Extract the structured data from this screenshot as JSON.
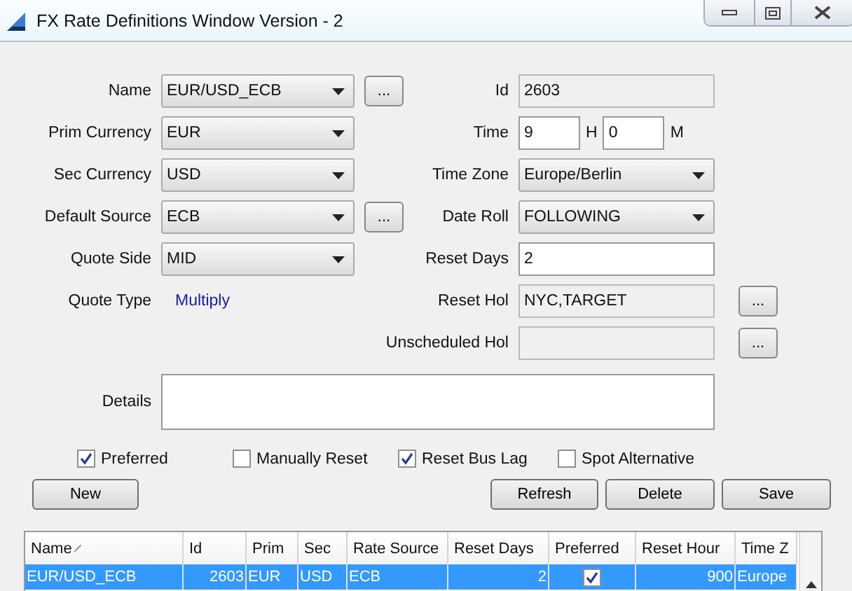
{
  "window": {
    "title": "FX Rate Definitions Window Version - 2"
  },
  "rows": [
    {
      "left": {
        "label": "Name",
        "kind": "dropdown",
        "value": "EUR/USD_ECB",
        "browse": "..."
      },
      "right": {
        "label": "Id",
        "kind": "readonly",
        "value": "2603"
      }
    },
    {
      "left": {
        "label": "Prim Currency",
        "kind": "dropdown",
        "value": "EUR"
      },
      "right": {
        "label": "Time",
        "kind": "time",
        "hours": "9",
        "hours_unit": "H",
        "minutes": "0",
        "minutes_unit": "M"
      }
    },
    {
      "left": {
        "label": "Sec Currency",
        "kind": "dropdown",
        "value": "USD"
      },
      "right": {
        "label": "Time Zone",
        "kind": "dropdown",
        "value": "Europe/Berlin"
      }
    },
    {
      "left": {
        "label": "Default Source",
        "kind": "dropdown",
        "value": "ECB",
        "browse": "..."
      },
      "right": {
        "label": "Date Roll",
        "kind": "dropdown",
        "value": "FOLLOWING"
      }
    },
    {
      "left": {
        "label": "Quote Side",
        "kind": "dropdown",
        "value": "MID"
      },
      "right": {
        "label": "Reset Days",
        "kind": "input",
        "value": "2"
      }
    },
    {
      "left": {
        "label": "Quote Type",
        "kind": "link",
        "value": "Multiply"
      },
      "right": {
        "label": "Reset Hol",
        "kind": "readonly",
        "value": "NYC,TARGET",
        "browse": "..."
      }
    },
    {
      "right": {
        "label": "Unscheduled Hol",
        "kind": "readonly",
        "browse": "..."
      }
    }
  ],
  "details": {
    "label": "Details"
  },
  "checkboxes": [
    {
      "label": "Preferred",
      "checked": true
    },
    {
      "label": "Manually Reset",
      "checked": false
    },
    {
      "label": "Reset Bus Lag",
      "checked": true
    },
    {
      "label": "Spot Alternative",
      "checked": false
    }
  ],
  "buttons_left": [
    "New"
  ],
  "buttons_right": [
    "Refresh",
    "Delete",
    "Save"
  ],
  "table": {
    "columns": [
      {
        "label": "Name",
        "sorted": true
      },
      {
        "label": "Id",
        "sorted": false
      },
      {
        "label": "Prim",
        "sorted": false
      },
      {
        "label": "Sec",
        "sorted": false
      },
      {
        "label": "Rate Source",
        "sorted": false
      },
      {
        "label": "Reset Days",
        "sorted": false
      },
      {
        "label": "Preferred",
        "sorted": false
      },
      {
        "label": "Reset Hour",
        "sorted": false
      },
      {
        "label": "Time Z",
        "sorted": false
      }
    ],
    "rows": [
      {
        "selected": true,
        "cells": [
          {
            "kind": "text",
            "text": "EUR/USD_ECB"
          },
          {
            "kind": "number",
            "text": "2603"
          },
          {
            "kind": "text",
            "text": "EUR"
          },
          {
            "kind": "text",
            "text": "USD"
          },
          {
            "kind": "text",
            "text": "ECB"
          },
          {
            "kind": "number",
            "text": "2"
          },
          {
            "kind": "check",
            "checked": true
          },
          {
            "kind": "number",
            "text": "900"
          },
          {
            "kind": "text",
            "text": "Europe"
          }
        ]
      }
    ]
  }
}
